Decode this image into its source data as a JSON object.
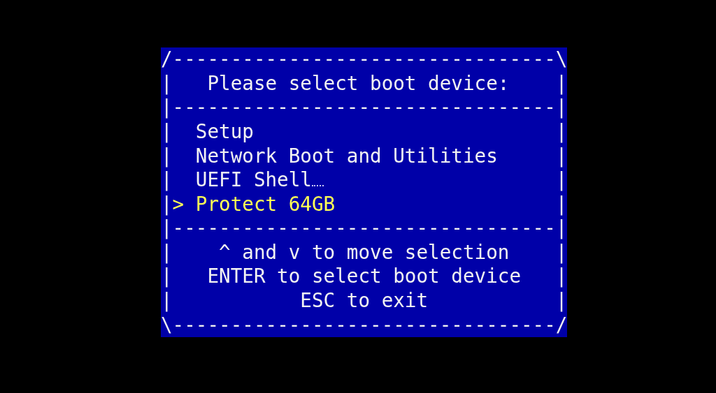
{
  "screen": {
    "frame_top": "/---------------------------------\\",
    "header": {
      "left": "|",
      "text": "Please select boot device:",
      "right": "|"
    },
    "divider_top": "|---------------------------------|",
    "selection_marker": ">",
    "items": [
      {
        "left": "|",
        "label": "Setup",
        "right": "|",
        "selected": false,
        "cursor_mark": false
      },
      {
        "left": "|",
        "label": "Network Boot and Utilities",
        "right": "|",
        "selected": false,
        "cursor_mark": false
      },
      {
        "left": "|",
        "label": "UEFI Shell",
        "right": "|",
        "selected": false,
        "cursor_mark": true
      },
      {
        "left": "|",
        "label": "Protect 64GB",
        "right": "|",
        "selected": true,
        "cursor_mark": false
      }
    ],
    "divider_bottom": "|---------------------------------|",
    "help": [
      {
        "left": "|",
        "text": "^ and v to move selection",
        "right": "|"
      },
      {
        "left": "|",
        "text": "ENTER to select boot device",
        "right": "|"
      },
      {
        "left": "|",
        "text": "ESC to exit",
        "right": "|"
      }
    ],
    "frame_bottom": "\\---------------------------------/"
  }
}
